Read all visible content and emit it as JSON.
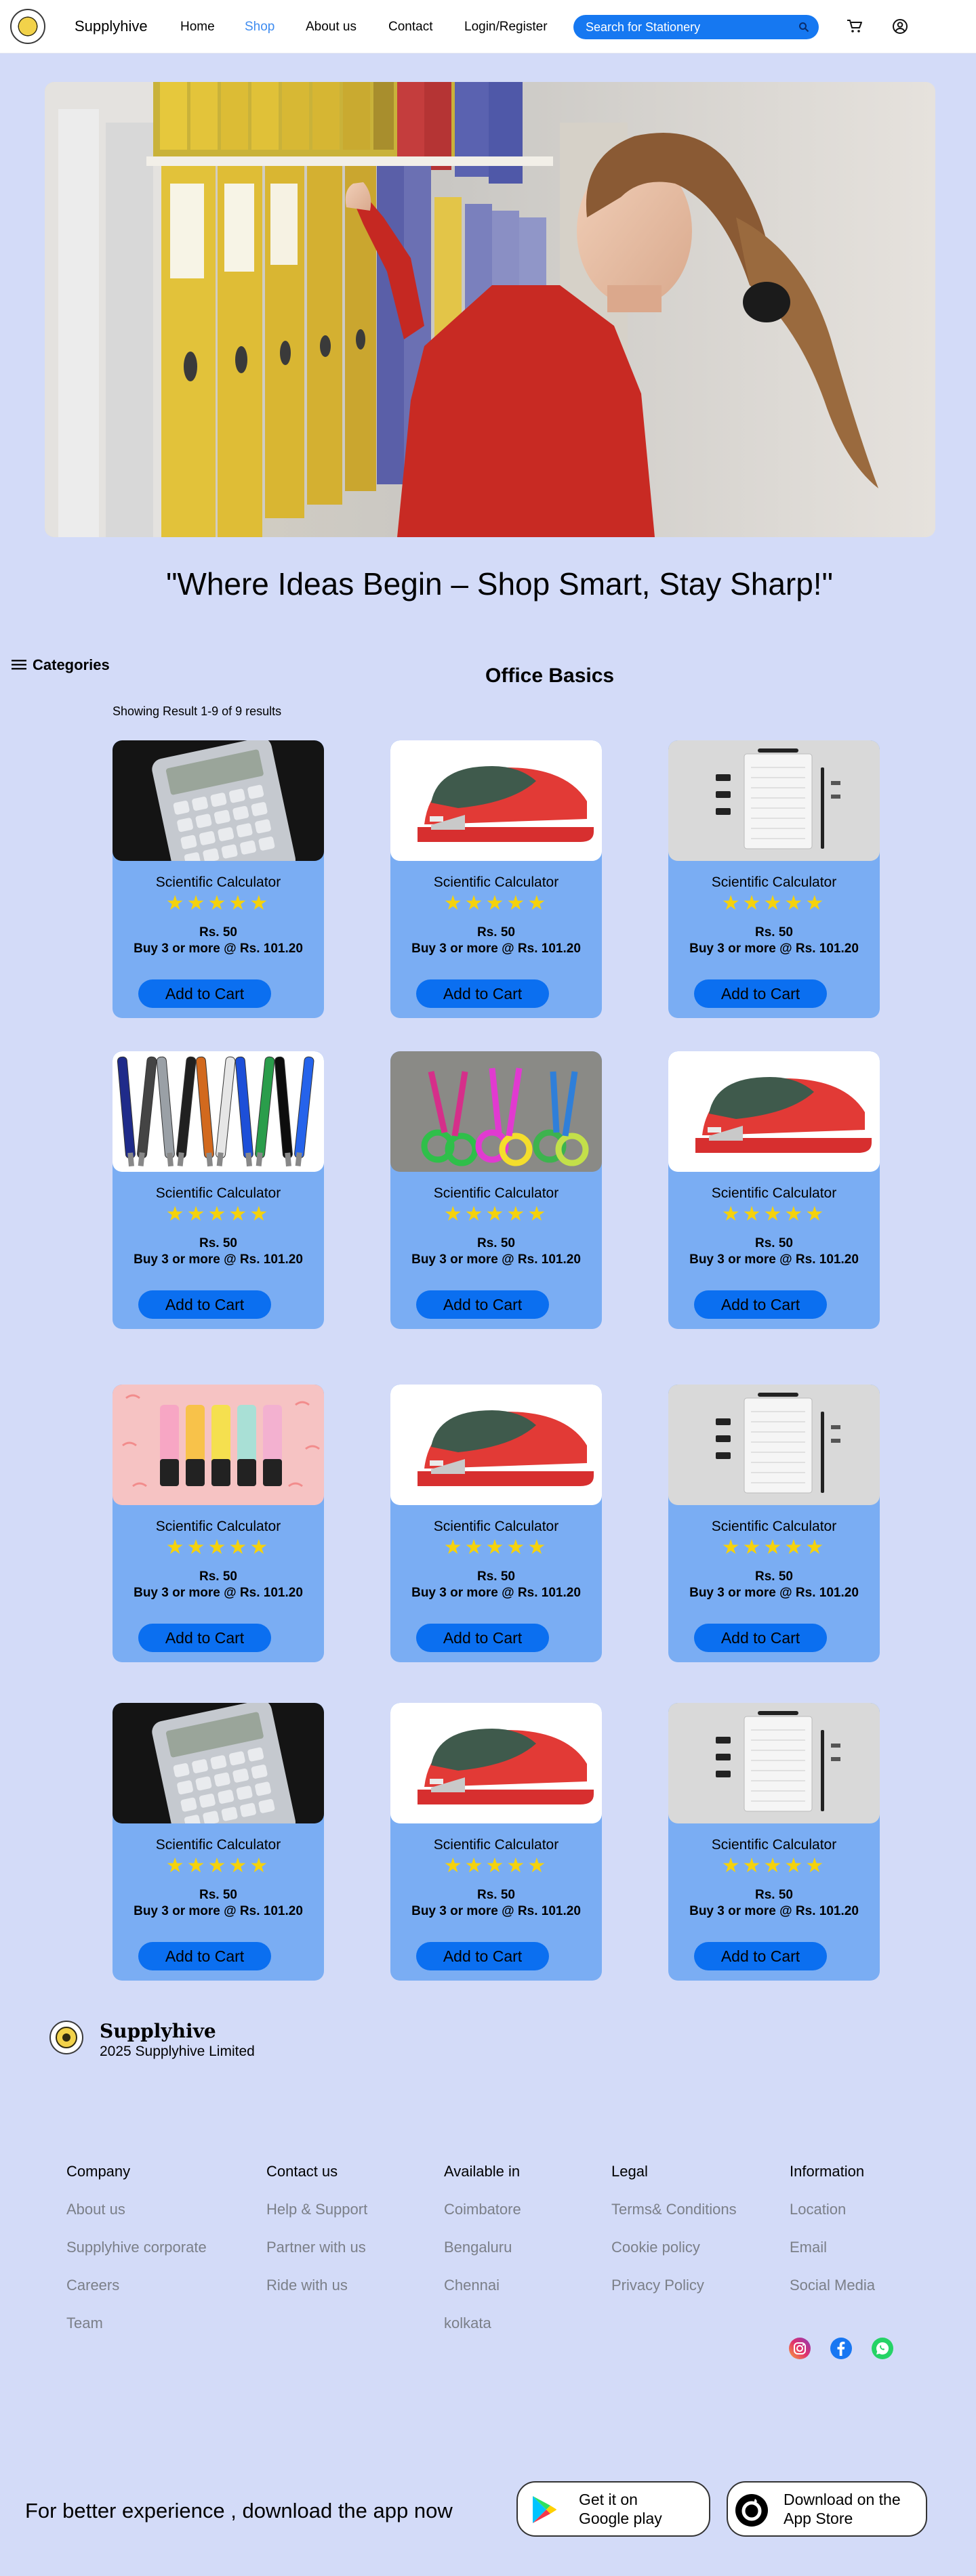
{
  "header": {
    "brand": "Supplyhive",
    "nav": [
      "Home",
      "Shop",
      "About us",
      "Contact",
      "Login/Register"
    ],
    "active_nav": "Shop",
    "search_placeholder": "Search for Stationery",
    "icons": [
      "cart-icon",
      "user-icon"
    ]
  },
  "hero": {
    "image": "woman-reaching-for-binders-on-shelf",
    "tagline": "\"Where Ideas Begin – Shop Smart, Stay Sharp!\""
  },
  "sidebar": {
    "categories_label": "Categories"
  },
  "main": {
    "section_title": "Office Basics",
    "results_text": "Showing Result 1-9 of 9 results",
    "products": [
      {
        "name": "Scientific Calculator",
        "image": "calculator",
        "rating": 5,
        "price": "Rs. 50",
        "bulk": "Buy 3 or more @ Rs. 101.20",
        "cta": "Add to Cart"
      },
      {
        "name": "Scientific Calculator",
        "image": "stapler",
        "rating": 5,
        "price": "Rs. 50",
        "bulk": "Buy 3 or more @ Rs. 101.20",
        "cta": "Add to Cart"
      },
      {
        "name": "Scientific Calculator",
        "image": "notepad",
        "rating": 5,
        "price": "Rs. 50",
        "bulk": "Buy 3 or more @ Rs. 101.20",
        "cta": "Add to Cart"
      },
      {
        "name": "Scientific Calculator",
        "image": "pens",
        "rating": 5,
        "price": "Rs. 50",
        "bulk": "Buy 3 or more @ Rs. 101.20",
        "cta": "Add to Cart"
      },
      {
        "name": "Scientific Calculator",
        "image": "scissors",
        "rating": 5,
        "price": "Rs. 50",
        "bulk": "Buy 3 or more @ Rs. 101.20",
        "cta": "Add to Cart"
      },
      {
        "name": "Scientific Calculator",
        "image": "stapler",
        "rating": 5,
        "price": "Rs. 50",
        "bulk": "Buy 3 or more @ Rs. 101.20",
        "cta": "Add to Cart"
      },
      {
        "name": "Scientific Calculator",
        "image": "highlighters",
        "rating": 5,
        "price": "Rs. 50",
        "bulk": "Buy 3 or more @ Rs. 101.20",
        "cta": "Add to Cart"
      },
      {
        "name": "Scientific Calculator",
        "image": "stapler",
        "rating": 5,
        "price": "Rs. 50",
        "bulk": "Buy 3 or more @ Rs. 101.20",
        "cta": "Add to Cart"
      },
      {
        "name": "Scientific Calculator",
        "image": "notepad",
        "rating": 5,
        "price": "Rs. 50",
        "bulk": "Buy 3 or more @ Rs. 101.20",
        "cta": "Add to Cart"
      },
      {
        "name": "Scientific Calculator",
        "image": "calculator",
        "rating": 5,
        "price": "Rs. 50",
        "bulk": "Buy 3 or more @ Rs. 101.20",
        "cta": "Add to Cart"
      },
      {
        "name": "Scientific Calculator",
        "image": "stapler",
        "rating": 5,
        "price": "Rs. 50",
        "bulk": "Buy 3 or more @ Rs. 101.20",
        "cta": "Add to Cart"
      },
      {
        "name": "Scientific Calculator",
        "image": "notepad",
        "rating": 5,
        "price": "Rs. 50",
        "bulk": "Buy 3 or more @ Rs. 101.20",
        "cta": "Add to Cart"
      }
    ]
  },
  "footer": {
    "brand": "Supplyhive",
    "copyright": "2025 Supplyhive Limited",
    "columns": [
      {
        "heading": "Company",
        "links": [
          "About us",
          "Supplyhive corporate",
          "Careers",
          "Team"
        ]
      },
      {
        "heading": "Contact us",
        "links": [
          "Help & Support",
          "Partner with us",
          "Ride with us"
        ]
      },
      {
        "heading": "Available in",
        "links": [
          "Coimbatore",
          "Bengaluru",
          "Chennai",
          "kolkata"
        ]
      },
      {
        "heading": "Legal",
        "links": [
          "Terms& Conditions",
          "Cookie policy",
          "Privacy Policy"
        ]
      },
      {
        "heading": "Information",
        "links": [
          "Location",
          "Email",
          "Social Media"
        ]
      }
    ],
    "social_icons": [
      "instagram-icon",
      "facebook-icon",
      "whatsapp-icon"
    ],
    "app_prompt": "For better experience , download the app now",
    "google_play": {
      "line1": "Get it on",
      "line2": "Google play"
    },
    "app_store": {
      "line1": "Download on the",
      "line2": "App Store"
    }
  },
  "colors": {
    "page_bg": "#d3dbf8",
    "card_bg": "#7aadf3",
    "button": "#0b6ff0",
    "search": "#1678f1",
    "active_nav": "#3f8cf0",
    "stars": "#f5d20c"
  }
}
